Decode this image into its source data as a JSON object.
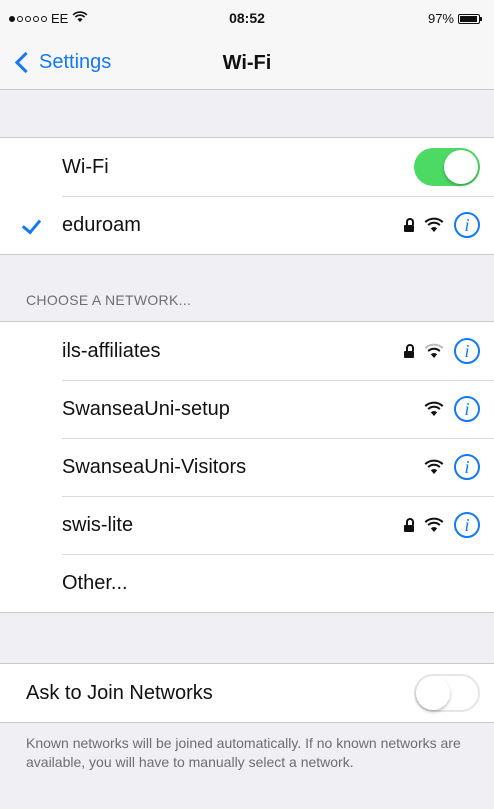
{
  "status_bar": {
    "carrier": "EE",
    "time": "08:52",
    "battery": "97%"
  },
  "nav": {
    "back_label": "Settings",
    "title": "Wi-Fi"
  },
  "wifi_toggle": {
    "label": "Wi-Fi",
    "state": "on"
  },
  "connected": {
    "name": "eduroam",
    "secured": true
  },
  "section_header": "CHOOSE A NETWORK...",
  "networks": [
    {
      "name": "ils-affiliates",
      "secured": true
    },
    {
      "name": "SwanseaUni-setup",
      "secured": false
    },
    {
      "name": "SwanseaUni-Visitors",
      "secured": false
    },
    {
      "name": "swis-lite",
      "secured": true
    }
  ],
  "other_label": "Other...",
  "ask_to_join": {
    "label": "Ask to Join Networks",
    "state": "off"
  },
  "footer": "Known networks will be joined automatically. If no known networks are available, you will have to manually select a network.",
  "colors": {
    "accent": "#1479f2",
    "toggle_on": "#4cd964",
    "background": "#efeff4"
  }
}
